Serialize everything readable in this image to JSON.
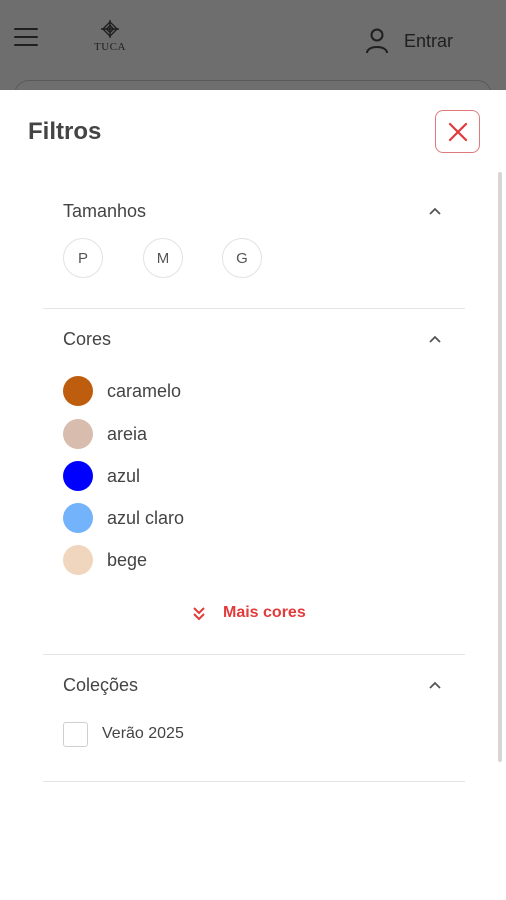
{
  "header": {
    "logo_text": "TUCA",
    "login_label": "Entrar"
  },
  "drawer": {
    "title": "Filtros",
    "sections": {
      "sizes": {
        "title": "Tamanhos",
        "options": [
          "P",
          "M",
          "G"
        ]
      },
      "colors": {
        "title": "Cores",
        "options": [
          {
            "label": "caramelo",
            "color": "#bf5d0e"
          },
          {
            "label": "areia",
            "color": "#d8bcad"
          },
          {
            "label": "azul",
            "color": "#0000ff"
          },
          {
            "label": "azul claro",
            "color": "#73b3fb"
          },
          {
            "label": "bege",
            "color": "#efd6bd"
          }
        ],
        "more_label": "Mais cores"
      },
      "collections": {
        "title": "Coleções",
        "options": [
          {
            "label": "Verão 2025",
            "checked": false
          }
        ]
      }
    }
  },
  "colors": {
    "accent": "#e23b3b",
    "overlay": "#6e6e6e"
  }
}
